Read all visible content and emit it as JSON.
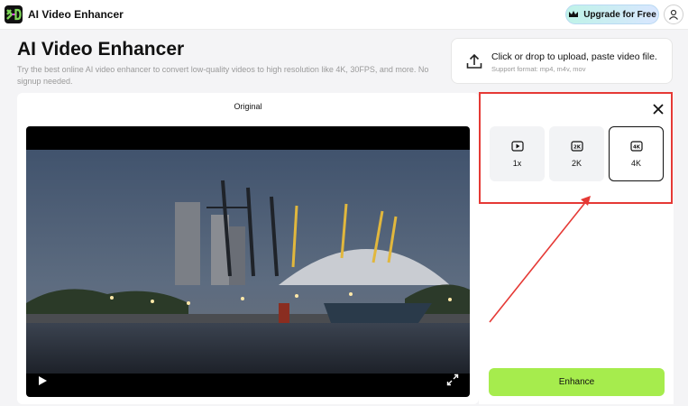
{
  "app": {
    "logo_text": "X-D",
    "title": "AI Video Enhancer",
    "upgrade_label": "Upgrade for Free"
  },
  "header": {
    "title": "AI Video Enhancer",
    "description": "Try the best online AI video enhancer to convert low-quality videos to high resolution like 4K, 30FPS, and more. No signup needed."
  },
  "upload": {
    "title": "Click or drop to upload, paste video file.",
    "subtitle": "Support format: mp4, m4v, mov"
  },
  "preview": {
    "label": "Original"
  },
  "options": [
    {
      "label": "1x",
      "icon": "play-icon",
      "selected": false
    },
    {
      "label": "2K",
      "icon": "2k-icon",
      "selected": false
    },
    {
      "label": "4K",
      "icon": "4k-icon",
      "selected": true
    }
  ],
  "action": {
    "enhance_label": "Enhance"
  },
  "colors": {
    "accent_green": "#a6ec4d",
    "annotation_red": "#e53935",
    "logo_green": "#7ed957",
    "logo_pink": "#e040fb"
  }
}
